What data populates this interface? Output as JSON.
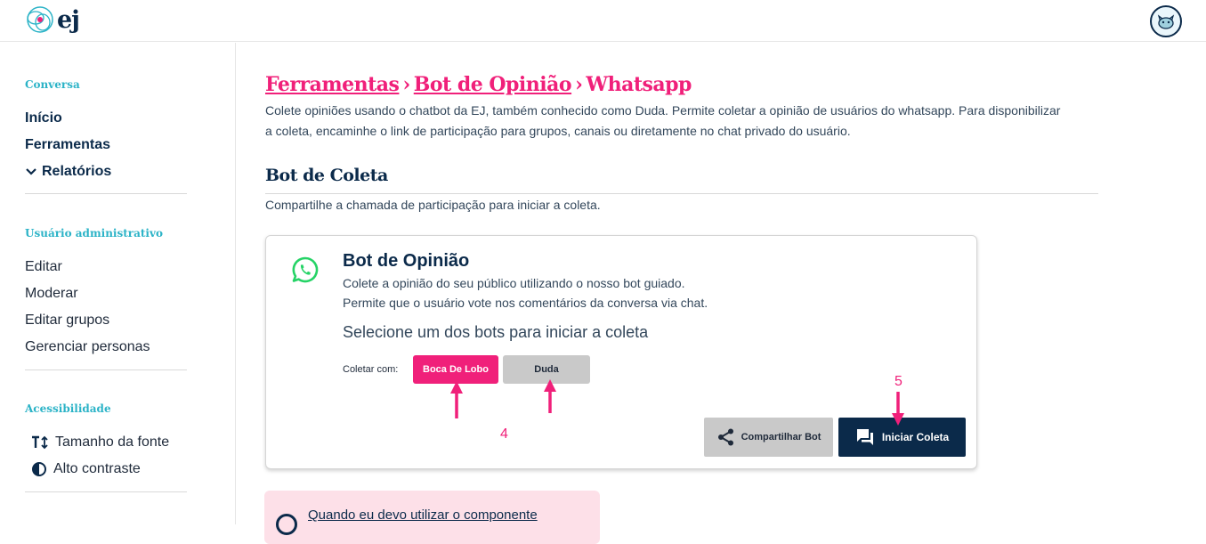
{
  "header": {
    "logo_text": "ej",
    "avatar_icon": "cat-avatar-icon"
  },
  "sidebar": {
    "section_conversa": "Conversa",
    "inicio": "Início",
    "ferramentas": "Ferramentas",
    "relatorios": "Relatórios",
    "section_admin": "Usuário administrativo",
    "editar": "Editar",
    "moderar": "Moderar",
    "editar_grupos": "Editar grupos",
    "gerenciar_personas": "Gerenciar personas",
    "section_acess": "Acessibilidade",
    "tamanho_fonte": "Tamanho da fonte",
    "alto_contraste": "Alto contraste"
  },
  "breadcrumb": {
    "item1": "Ferramentas",
    "item2": "Bot de Opinião",
    "item3": "Whatsapp",
    "separator": "›"
  },
  "page": {
    "description": "Colete opiniões usando o chatbot da EJ, também conhecido como Duda. Permite coletar a opinião de usuários do whatsapp. Para disponibilizar a coleta, encaminhe o link de participação para grupos, canais ou diretamente no chat privado do usuário.",
    "section_title": "Bot de Coleta",
    "section_sub": "Compartilhe a chamada de participação para iniciar a coleta."
  },
  "card": {
    "title": "Bot de Opinião",
    "line1": "Colete a opinião do seu público utilizando o nosso bot guiado.",
    "line2": "Permite que o usuário vote nos comentários da conversa via chat.",
    "select_text": "Selecione um dos bots para iniciar a coleta",
    "collect_label": "Coletar com:",
    "bot1": "Boca De Lobo",
    "bot2": "Duda",
    "share_label": "Compartilhar Bot",
    "start_label": "Iniciar Coleta"
  },
  "annotations": {
    "label4": "4",
    "label5": "5"
  },
  "help": {
    "link": "Quando eu devo utilizar o componente"
  },
  "colors": {
    "accent": "#f0207a",
    "navy": "#0b2a4a",
    "teal": "#2bb3c7",
    "whatsapp": "#25d366"
  }
}
